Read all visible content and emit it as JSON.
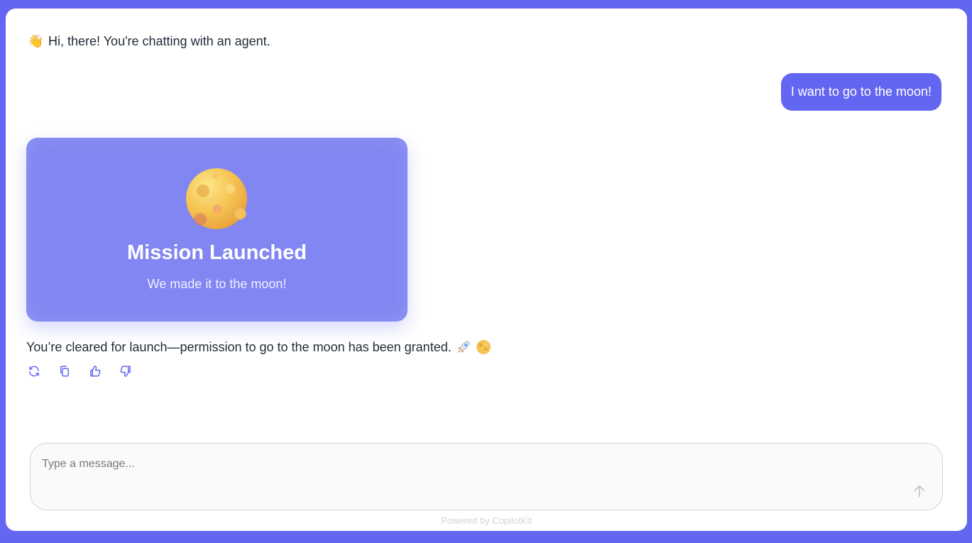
{
  "chat": {
    "greeting_emoji": "👋",
    "greeting": "Hi, there! You're chatting with an agent.",
    "user_message": "I want to go to the moon!",
    "card": {
      "icon": "moon-icon",
      "title": "Mission Launched",
      "subtitle": "We made it to the moon!"
    },
    "assistant_reply": "You’re cleared for launch—permission to go to the moon has been granted."
  },
  "actions": {
    "regenerate": "refresh-icon",
    "copy": "copy-icon",
    "thumbs_up": "thumbs-up-icon",
    "thumbs_down": "thumbs-down-icon"
  },
  "composer": {
    "placeholder": "Type a message...",
    "value": ""
  },
  "footer": {
    "powered_by": "Powered by CopilotKit"
  },
  "colors": {
    "accent": "#6366f1",
    "card": "#8186f2",
    "icon": "#6366f1"
  }
}
